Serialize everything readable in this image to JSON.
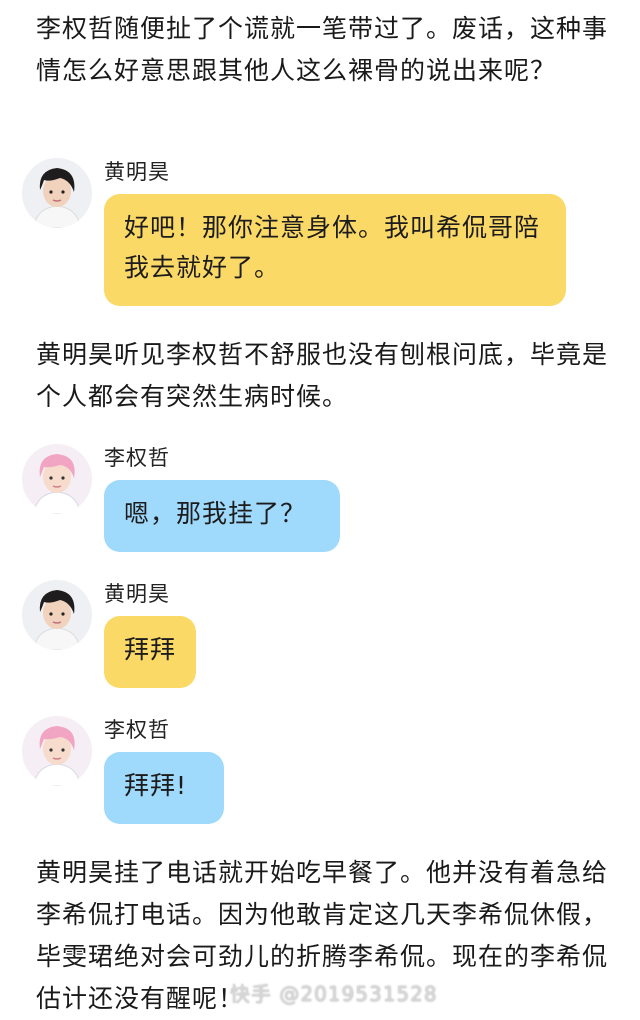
{
  "paragraphs": {
    "p1": "李权哲随便扯了个谎就一笔带过了。废话，这种事情怎么好意思跟其他人这么裸骨的说出来呢？",
    "p2": "黄明昊听见李权哲不舒服也没有刨根问底，毕竟是个人都会有突然生病时候。",
    "p3": "黄明昊挂了电话就开始吃早餐了。他并没有着急给李希侃打电话。因为他敢肯定这几天李希侃休假，毕雯珺绝对会可劲儿的折腾李希侃。现在的李希侃估计还没有醒呢！"
  },
  "messages": [
    {
      "sender": "黄明昊",
      "text": "好吧！那你注意身体。我叫希侃哥陪我去就好了。",
      "bubble_color": "#fbd967",
      "avatar_icon": "boy-avatar-dark-hair"
    },
    {
      "sender": "李权哲",
      "text": "嗯，那我挂了？",
      "bubble_color": "#9fd9fb",
      "avatar_icon": "boy-avatar-pink-hair"
    },
    {
      "sender": "黄明昊",
      "text": "拜拜",
      "bubble_color": "#fbd967",
      "avatar_icon": "boy-avatar-dark-hair"
    },
    {
      "sender": "李权哲",
      "text": "拜拜!",
      "bubble_color": "#9fd9fb",
      "avatar_icon": "boy-avatar-pink-hair"
    }
  ],
  "watermark": "快手 @2019531528"
}
